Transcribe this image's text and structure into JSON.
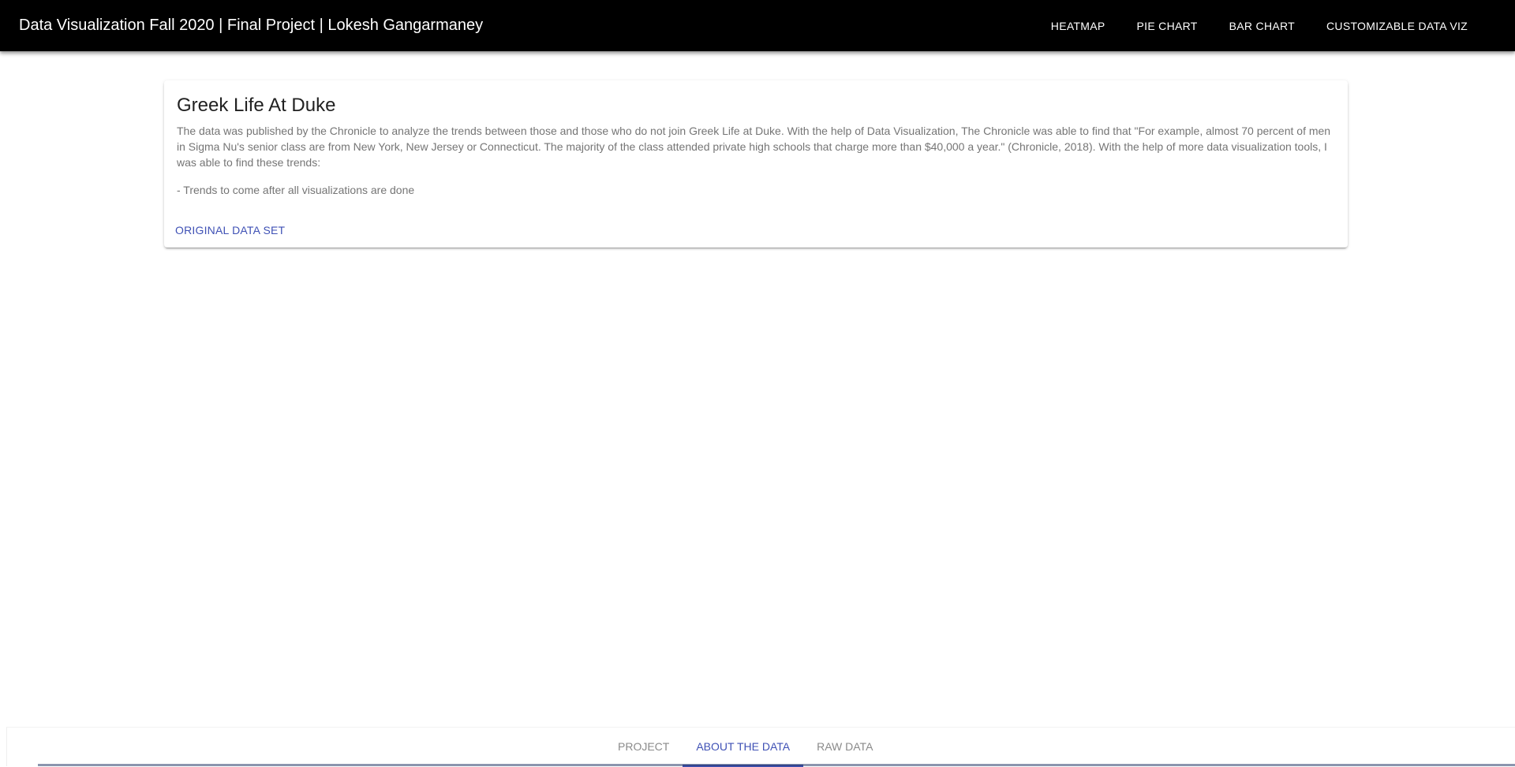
{
  "appbar": {
    "title": "Data Visualization Fall 2020 | Final Project | Lokesh Gangarmaney",
    "nav": [
      {
        "label": "HEATMAP"
      },
      {
        "label": "PIE CHART"
      },
      {
        "label": "BAR CHART"
      },
      {
        "label": "CUSTOMIZABLE DATA VIZ"
      }
    ]
  },
  "card": {
    "title": "Greek Life At Duke",
    "paragraphs": [
      "The data was published by the Chronicle to analyze the trends between those and those who do not join Greek Life at Duke. With the help of Data Visualization, The Chronicle was able to find that \"For example, almost 70 percent of men in Sigma Nu's senior class are from New York, New Jersey or Connecticut. The majority of the class attended private high schools that charge more than $40,000 a year.\" (Chronicle, 2018). With the help of more data visualization tools, I was able to find these trends:",
      "- Trends to come after all visualizations are done"
    ],
    "action_label": "ORIGINAL DATA SET"
  },
  "tabs": [
    {
      "label": "PROJECT",
      "active": false
    },
    {
      "label": "ABOUT THE DATA",
      "active": true
    },
    {
      "label": "RAW DATA",
      "active": false
    }
  ],
  "colors": {
    "accent": "#3f51b5",
    "appbar": "#000000"
  }
}
